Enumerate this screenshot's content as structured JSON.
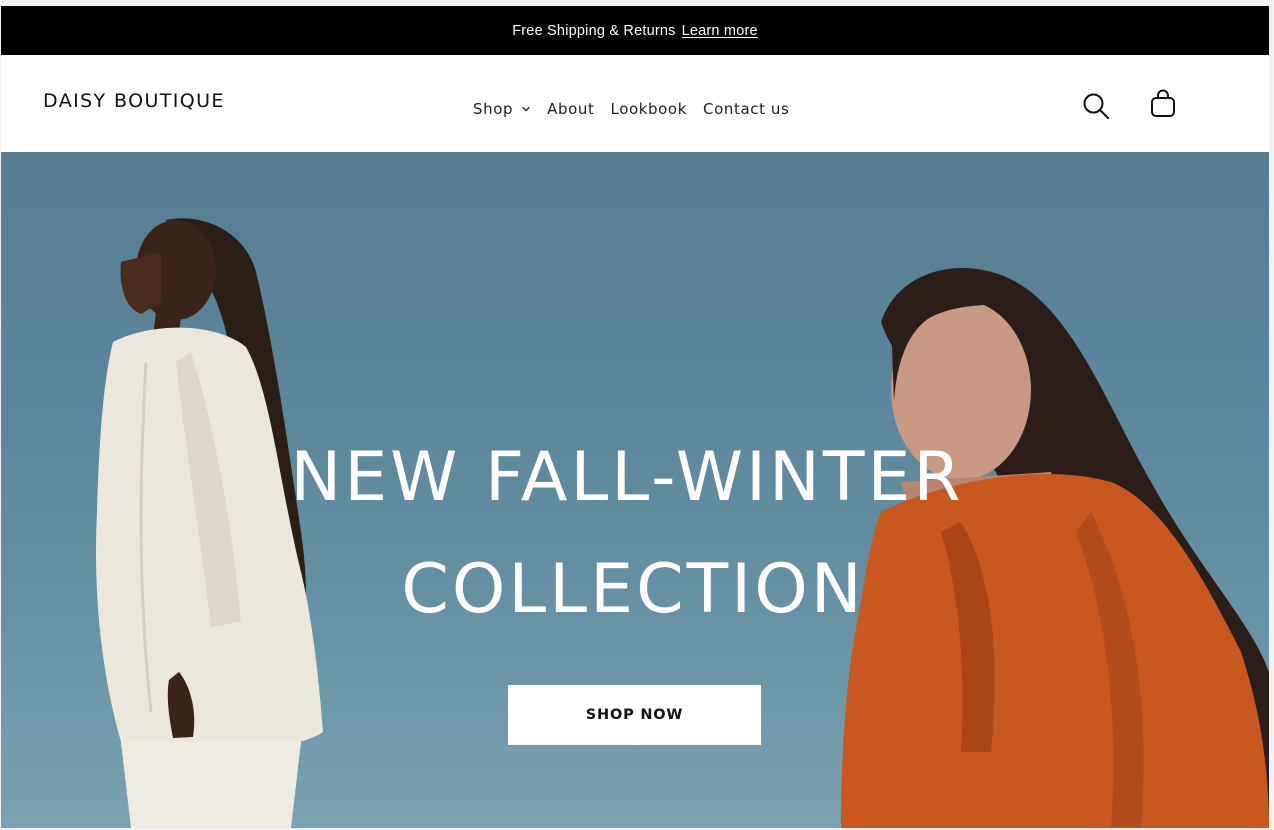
{
  "announcement": {
    "message": "Free Shipping & Returns",
    "link_label": "Learn more",
    "bg_color": "#000000"
  },
  "header": {
    "logo": "DAISY BOUTIQUE",
    "nav": [
      {
        "label": "Shop",
        "has_dropdown": true
      },
      {
        "label": "About"
      },
      {
        "label": "Lookbook"
      },
      {
        "label": "Contact us"
      }
    ],
    "icons": [
      "search-icon",
      "shopping-bag-icon"
    ]
  },
  "hero": {
    "title_line1": "NEW FALL-WINTER",
    "title_line2": "COLLECTION",
    "cta_label": "SHOP NOW",
    "image_description_colors": {
      "sky": "#5c879c",
      "suit_cream": "#ece6da",
      "coat_orange": "#c8581f"
    }
  }
}
